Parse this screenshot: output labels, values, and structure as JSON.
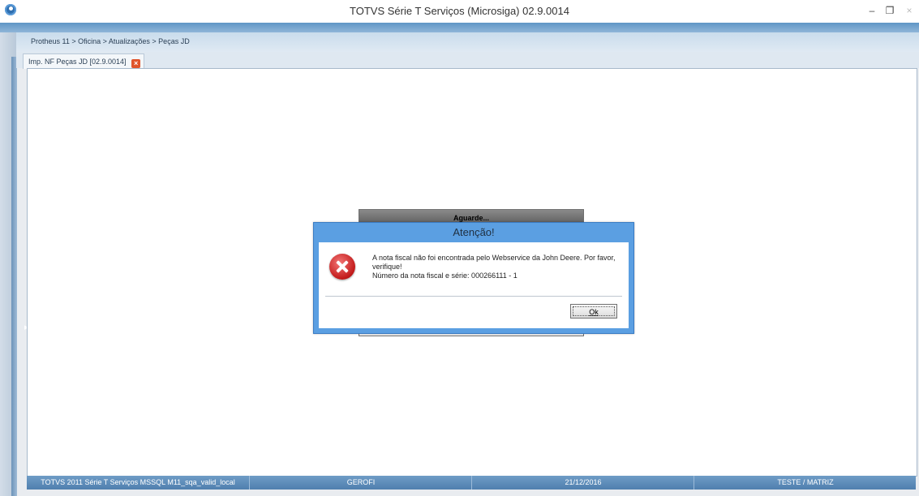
{
  "window": {
    "title": "TOTVS Série T Serviços (Microsiga) 02.9.0014",
    "controls": {
      "minimize": "–",
      "restore": "❐",
      "close": "×"
    }
  },
  "breadcrumb": "Protheus 11 > Oficina > Atualizações > Peças JD",
  "tab": {
    "label": "Imp. NF Peças JD [02.9.0014]",
    "close_icon": "close-icon"
  },
  "background_dialog": {
    "title": "Aguarde..."
  },
  "alert": {
    "title": "Atenção!",
    "icon": "error-icon",
    "message_line1": "A nota fiscal não foi encontrada pelo Webservice da John Deere. Por favor,",
    "message_line2": "verifique!",
    "message_line3": "Número da nota fiscal e série: 000266111 - 1",
    "ok_label": "Ok"
  },
  "statusbar": {
    "environment": "TOTVS 2011 Série T Serviços MSSQL M11_sqa_valid_local",
    "user": "GEROFI",
    "date": "21/12/2016",
    "company": "TESTE / MATRIZ"
  },
  "colors": {
    "accent": "#5b9fe2",
    "status_bar": "#5f8ebb",
    "error": "#c21a1a"
  }
}
